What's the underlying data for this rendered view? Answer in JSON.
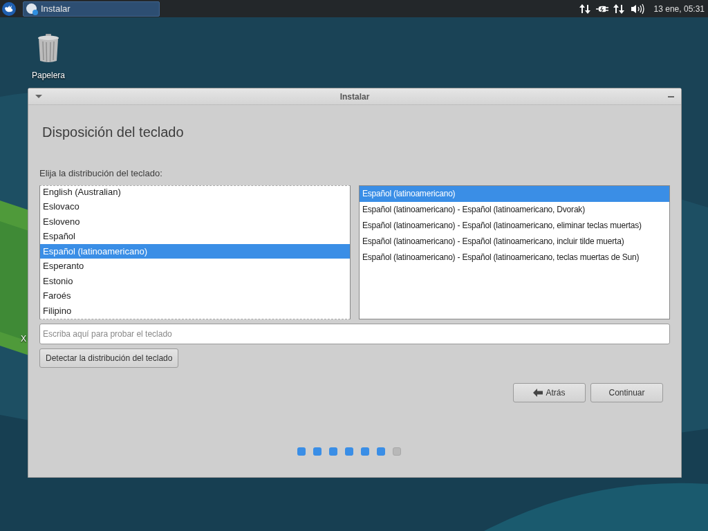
{
  "panel": {
    "taskbar": [
      {
        "label": "Instalar",
        "selected": true
      }
    ],
    "clock": "13 ene, 05:31"
  },
  "desktop_icons": [
    {
      "label": "Papelera",
      "kind": "trash"
    },
    {
      "label": "X",
      "kind": "hidden"
    }
  ],
  "window": {
    "title": "Instalar",
    "heading": "Disposición del teclado",
    "prompt": "Elija la distribución del teclado:",
    "layouts": [
      {
        "label": "English (Australian)",
        "selected": false
      },
      {
        "label": "Eslovaco",
        "selected": false
      },
      {
        "label": "Esloveno",
        "selected": false
      },
      {
        "label": "Español",
        "selected": false
      },
      {
        "label": "Español (latinoamericano)",
        "selected": true
      },
      {
        "label": "Esperanto",
        "selected": false
      },
      {
        "label": "Estonio",
        "selected": false
      },
      {
        "label": "Faroés",
        "selected": false
      },
      {
        "label": "Filipino",
        "selected": false
      }
    ],
    "variants": [
      {
        "label": "Español (latinoamericano)",
        "selected": true
      },
      {
        "label": "Español (latinoamericano) - Español (latinoamericano, Dvorak)",
        "selected": false
      },
      {
        "label": "Español (latinoamericano) - Español (latinoamericano, eliminar teclas muertas)",
        "selected": false
      },
      {
        "label": "Español (latinoamericano) - Español (latinoamericano, incluir tilde muerta)",
        "selected": false
      },
      {
        "label": "Español (latinoamericano) - Español (latinoamericano, teclas muertas de Sun)",
        "selected": false
      }
    ],
    "test_field": {
      "placeholder": "Escriba aquí para probar el teclado"
    },
    "detect_button": "Detectar la distribución del teclado",
    "buttons": [
      {
        "label": "Atrás",
        "kind": "back"
      },
      {
        "label": "Continuar",
        "kind": "next"
      }
    ],
    "steps": [
      {
        "done": true
      },
      {
        "done": true
      },
      {
        "done": true
      },
      {
        "done": true
      },
      {
        "done": true
      },
      {
        "done": true
      },
      {
        "done": false
      }
    ]
  }
}
